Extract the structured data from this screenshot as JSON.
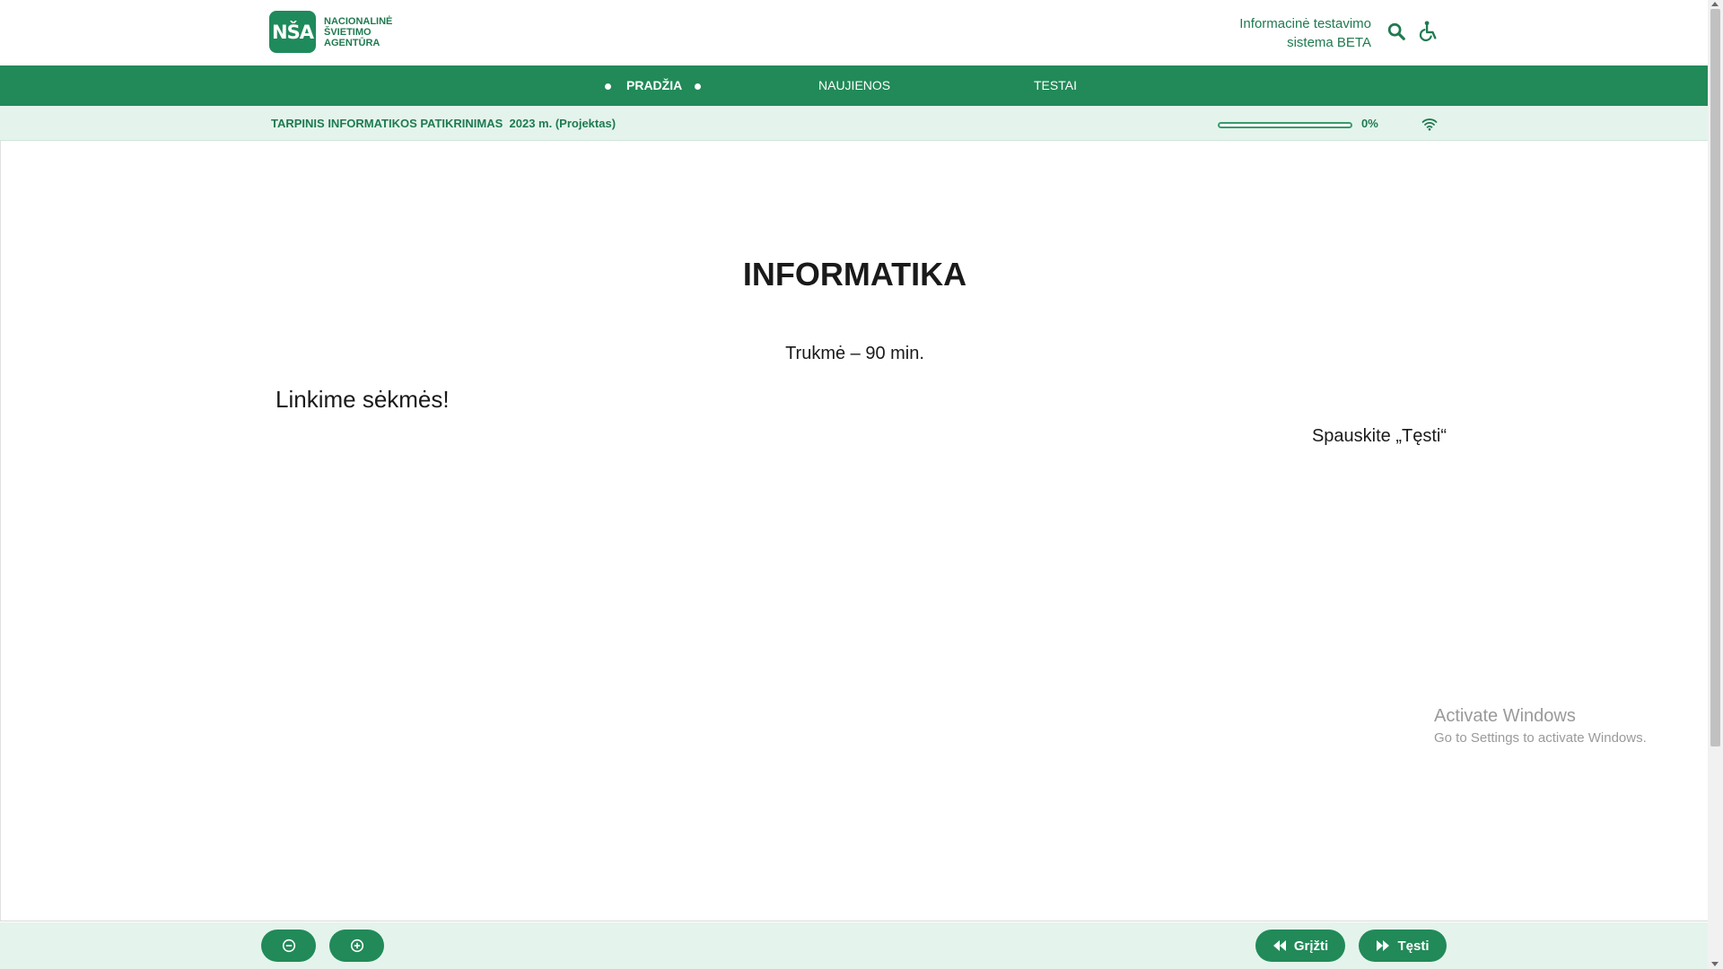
{
  "header": {
    "logo_badge": "NŠA",
    "logo_text_lines": [
      "NACIONALINĖ",
      "ŠVIETIMO",
      "AGENTŪRA"
    ],
    "system_title_line1": "Informacinė testavimo",
    "system_title_line2": "sistema BETA",
    "icons": [
      "search-icon",
      "accessibility-icon"
    ]
  },
  "nav": {
    "items": [
      {
        "label": "PRADŽIA",
        "active": true
      },
      {
        "label": "NAUJIENOS",
        "active": false
      },
      {
        "label": "TESTAI",
        "active": false
      }
    ]
  },
  "subbar": {
    "exam_title": "TARPINIS INFORMATIKOS PATIKRINIMAS  2023 m. (Projektas)",
    "progress_value": 0,
    "progress_label": "0%",
    "connection_icon": "wifi-icon"
  },
  "content": {
    "subject": "INFORMATIKA",
    "duration": "Trukmė – 90 min.",
    "good_luck": "Linkime sėkmės!",
    "instruction": "Spauskite „Tęsti“"
  },
  "watermark": {
    "title": "Activate Windows",
    "subtitle": "Go to Settings to activate Windows."
  },
  "footer": {
    "zoom_out_icon": "zoom-out-icon",
    "zoom_in_icon": "zoom-in-icon",
    "back_label": "Grįžti",
    "next_label": "Tęsti"
  },
  "colors": {
    "brand_green": "#218a58",
    "subbar_bg": "#e4f4ec",
    "text_green": "#1f7a50"
  }
}
